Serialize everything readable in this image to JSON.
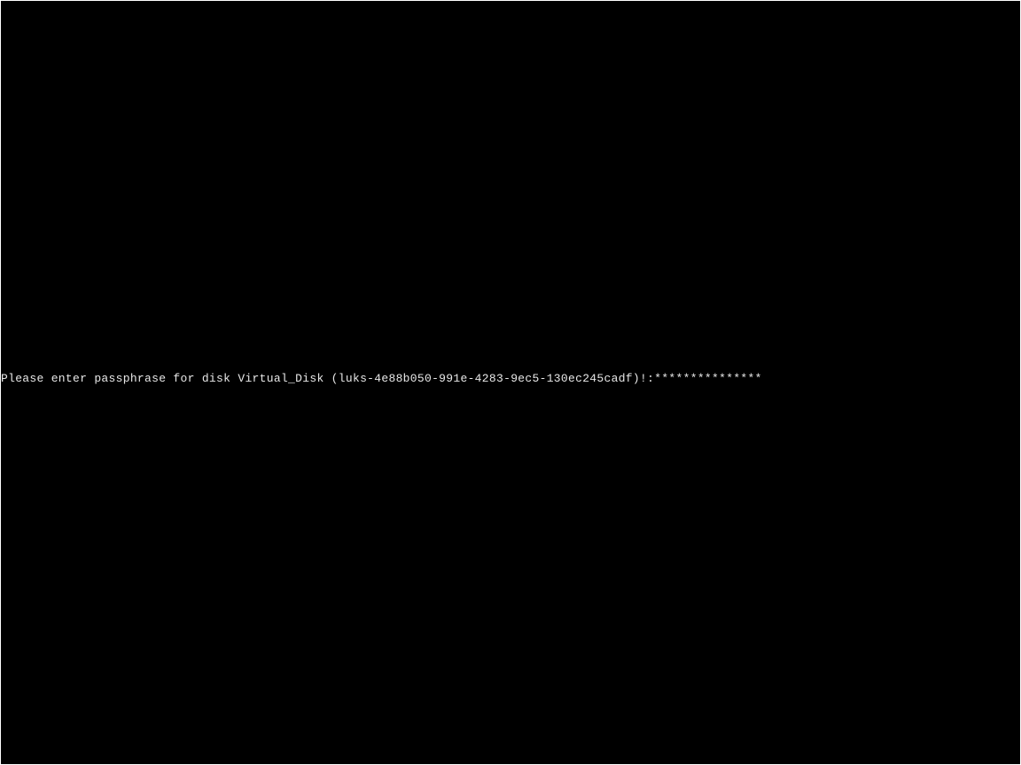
{
  "console": {
    "prompt_label": "Please enter passphrase for disk Virtual_Disk (luks-4e88b050-991e-4283-9ec5-130ec245cadf)!:",
    "passphrase_masked": "***************"
  }
}
